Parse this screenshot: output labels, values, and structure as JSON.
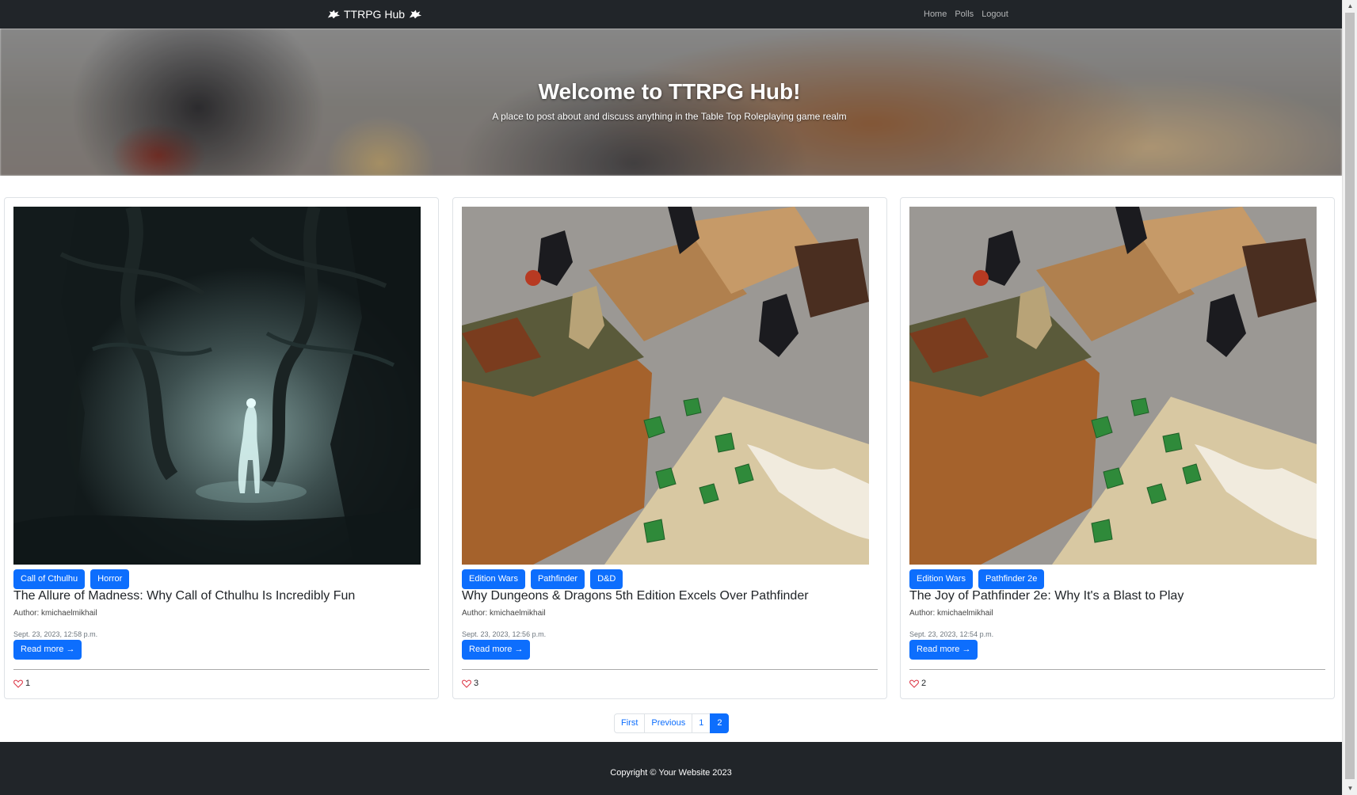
{
  "navbar": {
    "brand": "TTRPG Hub",
    "links": [
      "Home",
      "Polls",
      "Logout"
    ]
  },
  "hero": {
    "title": "Welcome to TTRPG Hub!",
    "subtitle": "A place to post about and discuss anything in the Table Top Roleplaying game realm"
  },
  "posts": [
    {
      "tags": [
        "Call of Cthulhu",
        "Horror"
      ],
      "title": "The Allure of Madness: Why Call of Cthulhu Is Incredibly Fun",
      "author": "Author: kmichaelmikhail",
      "date": "Sept. 23, 2023, 12:58 p.m.",
      "read_more": "Read more →",
      "likes": "1",
      "image": "dark-forest-ghost"
    },
    {
      "tags": [
        "Edition Wars",
        "Pathfinder",
        "D&D"
      ],
      "title": "Why Dungeons & Dragons 5th Edition Excels Over Pathfinder",
      "author": "Author: kmichaelmikhail",
      "date": "Sept. 23, 2023, 12:56 p.m.",
      "read_more": "Read more →",
      "likes": "3",
      "image": "dice-books-miniatures"
    },
    {
      "tags": [
        "Edition Wars",
        "Pathfinder 2e"
      ],
      "title": "The Joy of Pathfinder 2e: Why It's a Blast to Play",
      "author": "Author: kmichaelmikhail",
      "date": "Sept. 23, 2023, 12:54 p.m.",
      "read_more": "Read more →",
      "likes": "2",
      "image": "dice-books-miniatures"
    }
  ],
  "pagination": {
    "items": [
      "First",
      "Previous",
      "1",
      "2"
    ],
    "active": "2"
  },
  "footer": {
    "text": "Copyright © Your Website 2023"
  },
  "colors": {
    "primary": "#0d6efd",
    "dark": "#212529",
    "heart": "#dc3545"
  }
}
